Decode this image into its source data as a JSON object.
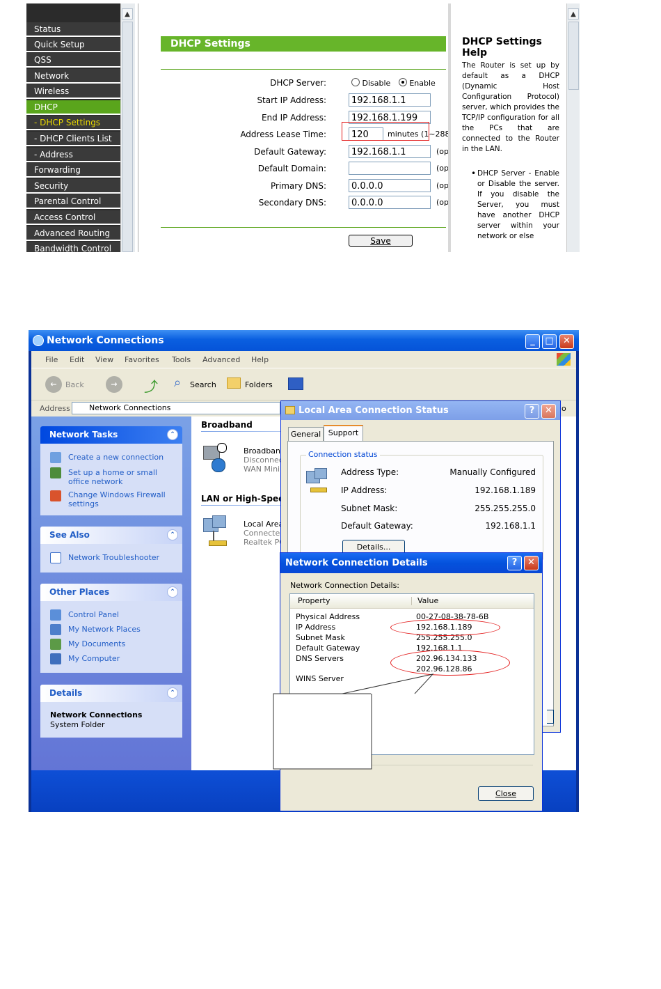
{
  "router": {
    "menu": [
      {
        "label": "Status",
        "active": false
      },
      {
        "label": "Quick Setup",
        "active": false
      },
      {
        "label": "QSS",
        "active": false
      },
      {
        "label": "Network",
        "active": false
      },
      {
        "label": "Wireless",
        "active": false
      },
      {
        "label": "DHCP",
        "active": true
      },
      {
        "label": "- DHCP Settings",
        "active": false
      },
      {
        "label": "- DHCP Clients List",
        "active": false
      },
      {
        "label": "- Address Reservation",
        "active": false
      },
      {
        "label": "Forwarding",
        "active": false
      },
      {
        "label": "Security",
        "active": false
      },
      {
        "label": "Parental Control",
        "active": false
      },
      {
        "label": "Access Control",
        "active": false
      },
      {
        "label": "Advanced Routing",
        "active": false
      },
      {
        "label": "Bandwidth Control",
        "active": false
      }
    ],
    "section_title": "DHCP Settings",
    "dhcp_server_label": "DHCP Server:",
    "disable_label": "Disable",
    "enable_label": "Enable",
    "fields": [
      {
        "label": "Start IP Address:",
        "value": "192.168.1.1",
        "opt": ""
      },
      {
        "label": "End IP Address:",
        "value": "192.168.1.199",
        "opt": ""
      },
      {
        "label": "Address Lease Time:",
        "value": "120",
        "opt": ""
      },
      {
        "label": "Default Gateway:",
        "value": "192.168.1.1",
        "opt": "(op"
      },
      {
        "label": "Default Domain:",
        "value": "",
        "opt": "(op"
      },
      {
        "label": "Primary DNS:",
        "value": "0.0.0.0",
        "opt": "(op"
      },
      {
        "label": "Secondary DNS:",
        "value": "0.0.0.0",
        "opt": "(op"
      }
    ],
    "lease_suffix": "minutes (1~288",
    "save_label": "Save",
    "help_title": "DHCP Settings Help",
    "help_text": "The Router is set up by default as a DHCP (Dynamic Host Configuration Protocol) server, which provides the TCP/IP configuration for all the PCs that are connected to the Router in the LAN.",
    "help_bullet": "DHCP Server - Enable or Disable the server. If you disable the Server, you must have another DHCP server within your network or else"
  },
  "explorer": {
    "title": "Network Connections",
    "menu": [
      "File",
      "Edit",
      "View",
      "Favorites",
      "Tools",
      "Advanced",
      "Help"
    ],
    "toolbar": {
      "back": "Back",
      "search": "Search",
      "folders": "Folders"
    },
    "address_label": "Address",
    "address_value": "Network Connections",
    "address_go_tail": "o",
    "tasks": {
      "network_tasks": {
        "title": "Network Tasks",
        "items": [
          "Create a new connection",
          "Set up a home or small office network",
          "Change Windows Firewall settings"
        ]
      },
      "see_also": {
        "title": "See Also",
        "items": [
          "Network Troubleshooter"
        ]
      },
      "other_places": {
        "title": "Other Places",
        "items": [
          "Control Panel",
          "My Network Places",
          "My Documents",
          "My Computer"
        ]
      },
      "details": {
        "title": "Details",
        "name": "Network Connections",
        "type": "System Folder"
      }
    },
    "groups": {
      "broadband": {
        "title": "Broadband",
        "name": "Broadban",
        "status": "Disconnec",
        "device": "WAN Minip"
      },
      "lan": {
        "title": "LAN or High-Speed",
        "name": "Local Area",
        "status": "Connecte",
        "device": "Realtek PC"
      }
    }
  },
  "status_dialog": {
    "title": "Local Area Connection Status",
    "tabs": [
      "General",
      "Support"
    ],
    "group_title": "Connection status",
    "rows": [
      {
        "label": "Address Type:",
        "value": "Manually Configured"
      },
      {
        "label": "IP Address:",
        "value": "192.168.1.189"
      },
      {
        "label": "Subnet Mask:",
        "value": "255.255.255.0"
      },
      {
        "label": "Default Gateway:",
        "value": "192.168.1.1"
      }
    ],
    "details_button": "Details..."
  },
  "details_dialog": {
    "title": "Network Connection Details",
    "caption": "Network Connection Details:",
    "col_property": "Property",
    "col_value": "Value",
    "rows": [
      {
        "property": "Physical Address",
        "value": "00-27-08-38-78-6B"
      },
      {
        "property": "IP Address",
        "value": "192.168.1.189"
      },
      {
        "property": "Subnet Mask",
        "value": "255.255.255.0"
      },
      {
        "property": "Default Gateway",
        "value": "192.168.1.1"
      },
      {
        "property": "DNS Servers",
        "value": "202.96.134.133"
      },
      {
        "property": "",
        "value": "202.96.128.86"
      },
      {
        "property": "WINS Server",
        "value": ""
      }
    ],
    "close_label": "Close"
  },
  "colors": {
    "router_green": "#5aa51c",
    "annotation_red": "#e31b1b",
    "xp_blue": "#0a5fe0"
  }
}
